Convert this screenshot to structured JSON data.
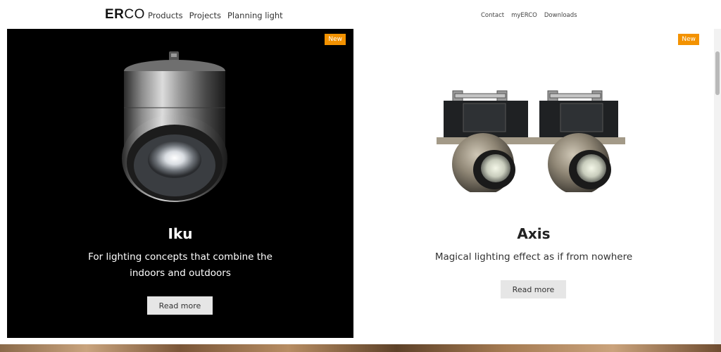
{
  "header": {
    "logo": {
      "bold": "ER",
      "light": "CO"
    },
    "main_nav": [
      "Products",
      "Projects",
      "Planning light"
    ],
    "sub_nav": [
      "Contact",
      "myERCO",
      "Downloads"
    ]
  },
  "cards": [
    {
      "badge": "New",
      "title": "Iku",
      "description": "For lighting concepts that combine the indoors and outdoors",
      "button": "Read more"
    },
    {
      "badge": "New",
      "title": "Axis",
      "description": "Magical lighting effect as if from nowhere",
      "button": "Read more"
    }
  ],
  "colors": {
    "badge": "#f39200",
    "dark_card_bg": "#000000",
    "button_bg": "#e6e6e6"
  }
}
